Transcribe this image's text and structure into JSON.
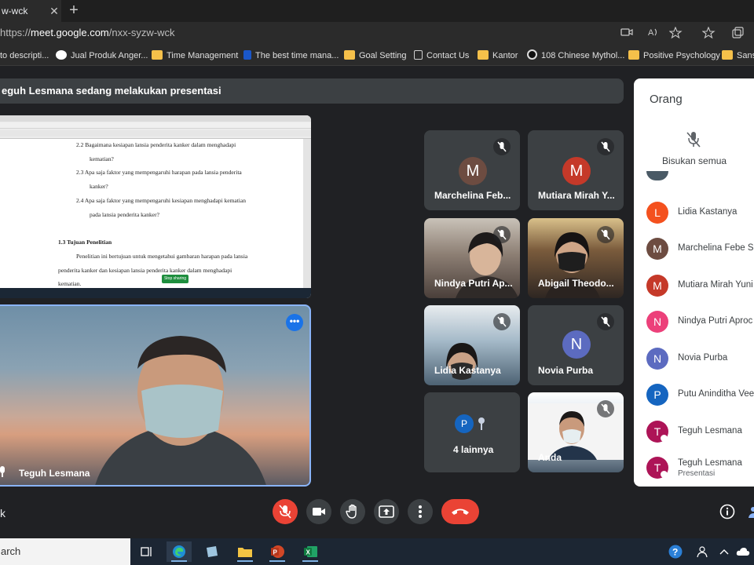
{
  "browser": {
    "tab_title": "w-wck",
    "tab_close": "✕",
    "new_tab": "+",
    "url_scheme": "https://",
    "url_host": "meet.google.com",
    "url_path": "/nxx-syzw-wck",
    "bookmarks": [
      {
        "label": "to descripti...",
        "icon": "folder-icon"
      },
      {
        "label": "Jual Produk Anger...",
        "icon": "google-icon"
      },
      {
        "label": "Time Management",
        "icon": "folder-icon"
      },
      {
        "label": "The best time mana...",
        "icon": "page-icon"
      },
      {
        "label": "Goal Setting",
        "icon": "folder-icon"
      },
      {
        "label": "Contact Us",
        "icon": "document-icon"
      },
      {
        "label": "Kantor",
        "icon": "folder-icon"
      },
      {
        "label": "108 Chinese Mythol...",
        "icon": "site-icon"
      },
      {
        "label": "Positive Psychology",
        "icon": "folder-icon"
      },
      {
        "label": "Sans",
        "icon": "folder-icon"
      }
    ]
  },
  "meet": {
    "presenting_banner": "eguh Lesmana sedang melakukan presentasi",
    "shared_doc": {
      "lines": [
        "2.2   Bagaimana kesiapan lansia penderita kanker dalam menghadapi",
        "kematian?",
        "2.3   Apa saja faktor yang mempengaruhi harapan pada lansia penderita",
        "kanker?",
        "2.4   Apa saja faktor yang mempengaruhi kesiapan menghadapi kematian",
        "pada lansia penderita kanker?",
        "1.3     Tujuan Penelitian",
        "Penelitian ini bertujuan untuk mengetahui gambaran harapan pada lansia",
        "penderita kanker dan kesiapan lansia penderita kanker dalam menghadapi",
        "kematian."
      ],
      "stop_sharing_label": "Stop sharing"
    },
    "presenter_name": "Teguh Lesmana",
    "tiles": [
      {
        "name": "Marchelina Feb...",
        "initial": "M",
        "color": "#6d4c41",
        "type": "avatar"
      },
      {
        "name": "Mutiara Mirah Y...",
        "initial": "M",
        "color": "#c53929",
        "type": "avatar"
      },
      {
        "name": "Nindya Putri Ap...",
        "type": "camera"
      },
      {
        "name": "Abigail Theodo...",
        "type": "camera"
      },
      {
        "name": "Lidia Kastanya",
        "type": "camera"
      },
      {
        "name": "Novia Purba",
        "initial": "N",
        "color": "#5c6bc0",
        "type": "avatar"
      },
      {
        "name": "4 lainnya",
        "initial": "P",
        "color": "#1565c0",
        "type": "others"
      },
      {
        "name": "Anda",
        "type": "camera"
      }
    ],
    "people_panel": {
      "title": "Orang",
      "mute_all_label": "Bisukan semua",
      "participants": [
        {
          "name": "Lidia Kastanya",
          "initial": "L",
          "color": "#f4511e",
          "sub": ""
        },
        {
          "name": "Marchelina Febe S",
          "initial": "M",
          "color": "#6d4c41",
          "sub": ""
        },
        {
          "name": "Mutiara Mirah Yuni",
          "initial": "M",
          "color": "#c53929",
          "sub": ""
        },
        {
          "name": "Nindya Putri Aproc",
          "initial": "N",
          "color": "#ec407a",
          "sub": ""
        },
        {
          "name": "Novia Purba",
          "initial": "N",
          "color": "#5c6bc0",
          "sub": ""
        },
        {
          "name": "Putu Aninditha Vee",
          "initial": "P",
          "color": "#1565c0",
          "sub": ""
        },
        {
          "name": "Teguh Lesmana",
          "initial": "T",
          "color": "#ad1457",
          "sub": ""
        },
        {
          "name": "Teguh Lesmana",
          "initial": "T",
          "color": "#ad1457",
          "sub": "Presentasi"
        }
      ]
    },
    "bottom_left_text": "k",
    "controls": {
      "mic_color": "#ea4335",
      "end_call_color": "#ea4335"
    }
  },
  "taskbar": {
    "search_text": "arch"
  }
}
